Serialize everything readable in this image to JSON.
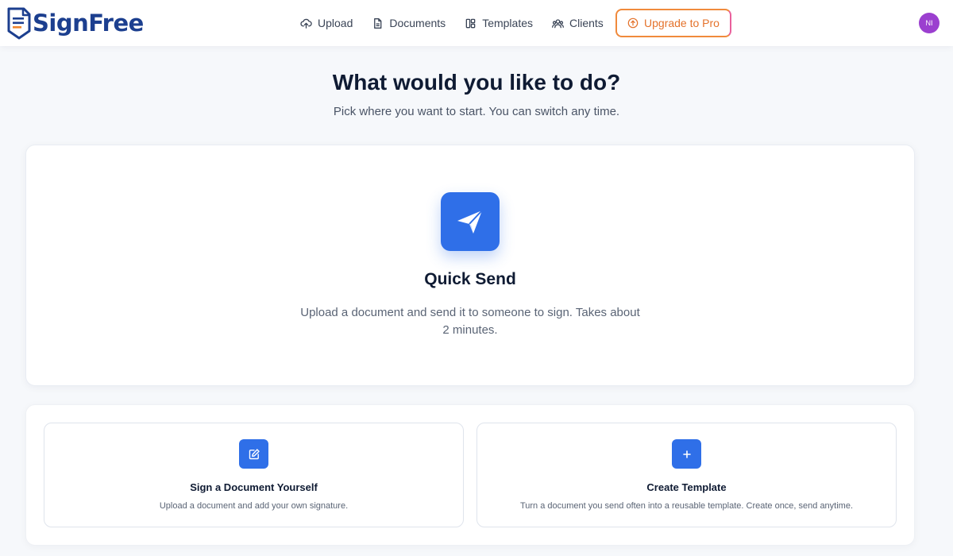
{
  "brand": {
    "name": "SignFree",
    "accent": "#1c3f8f"
  },
  "nav": {
    "items": [
      {
        "label": "Upload",
        "icon": "upload-cloud-icon"
      },
      {
        "label": "Documents",
        "icon": "document-icon"
      },
      {
        "label": "Templates",
        "icon": "templates-grid-icon"
      },
      {
        "label": "Clients",
        "icon": "users-icon"
      }
    ],
    "upgrade_label": "Upgrade to Pro",
    "upgrade_icon": "arrow-up-circle-icon"
  },
  "user": {
    "initials": "NI",
    "avatar_color": "#9b3fcf"
  },
  "page": {
    "title": "What would you like to do?",
    "subtitle": "Pick where you want to start. You can switch any time."
  },
  "hero": {
    "title": "Quick Send",
    "description": "Upload a document and send it to someone to sign. Takes about 2 minutes.",
    "icon": "paper-plane-icon",
    "icon_color": "#2f6fe8"
  },
  "options": [
    {
      "title": "Sign a Document Yourself",
      "description": "Upload a document and add your own signature.",
      "icon": "edit-pen-icon"
    },
    {
      "title": "Create Template",
      "description": "Turn a document you send often into a reusable template. Create once, send anytime.",
      "icon": "plus-icon"
    }
  ]
}
